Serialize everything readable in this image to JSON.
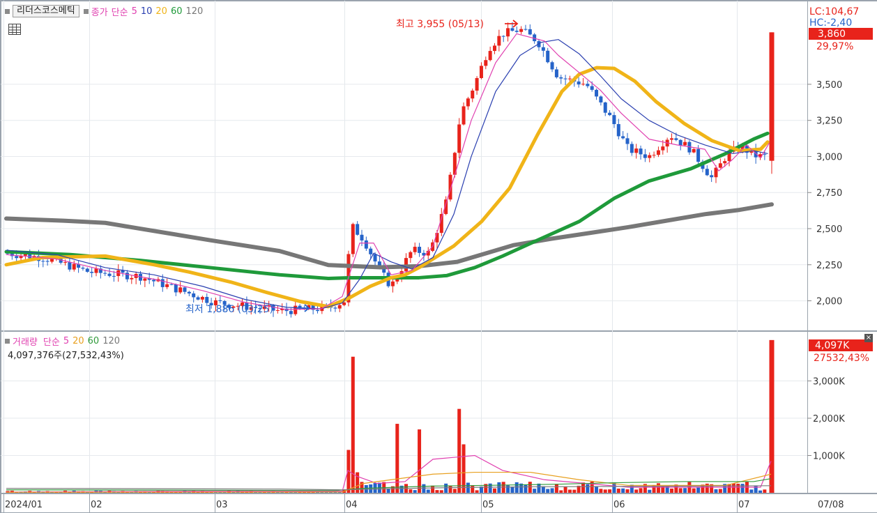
{
  "price_legend": {
    "title": "리더스코스메틱",
    "close_label": "종가",
    "ma_label": "단순",
    "periods": [
      "5",
      "10",
      "20",
      "60",
      "120"
    ]
  },
  "volume_legend": {
    "title": "거래량",
    "ma_label": "단순",
    "periods": [
      "5",
      "20",
      "60",
      "120"
    ],
    "readout": "4,097,376주(27,532,43%)"
  },
  "colors": {
    "up": "#e8231b",
    "down": "#2563c9",
    "ma5": "#e040b0",
    "ma10": "#2a3fb0",
    "ma20": "#f0b418",
    "ma60": "#1f9a3a",
    "ma120": "#777777",
    "vma5": "#e040b0",
    "vma20": "#e8a020",
    "vma60": "#2f9a3a",
    "vma120": "#7b7b7b"
  },
  "chart_data": [
    {
      "type": "candlestick",
      "title": "리더스코스메틱",
      "y_axis_labels": [
        "3,500",
        "3,250",
        "3,000",
        "2,750",
        "2,500",
        "2,250",
        "2,000"
      ],
      "ylim": [
        1800,
        4050
      ],
      "right_panel": {
        "lc": "LC:104,67",
        "hc": "HC:-2,40",
        "last_price": "3,860",
        "change_pct": "29,97%"
      },
      "annotations": {
        "high": "최고 3,955 (05/13)",
        "low": "최저 1,886 (03/25)"
      },
      "x_labels": [
        "2024/01",
        "02",
        "03",
        "04",
        "05",
        "06",
        "07",
        "07/08"
      ],
      "series": [
        {
          "name": "120",
          "points": [
            [
              2570,
              8
            ],
            [
              2555,
              90
            ],
            [
              2540,
              150
            ],
            [
              2500,
              200
            ],
            [
              2420,
              300
            ],
            [
              2345,
              400
            ],
            [
              2248,
              470
            ],
            [
              2232,
              545
            ],
            [
              2240,
              600
            ],
            [
              2270,
              655
            ],
            [
              2320,
              690
            ],
            [
              2385,
              735
            ],
            [
              2430,
              790
            ],
            [
              2470,
              845
            ],
            [
              2510,
              900
            ],
            [
              2555,
              955
            ],
            [
              2600,
              1010
            ],
            [
              2630,
              1060
            ],
            [
              2668,
              1106
            ]
          ]
        },
        {
          "name": "60",
          "points": [
            [
              2340,
              8
            ],
            [
              2320,
              100
            ],
            [
              2280,
              200
            ],
            [
              2230,
              300
            ],
            [
              2180,
              400
            ],
            [
              2155,
              470
            ],
            [
              2160,
              500
            ],
            [
              2160,
              545
            ],
            [
              2160,
              600
            ],
            [
              2175,
              640
            ],
            [
              2230,
              680
            ],
            [
              2310,
              720
            ],
            [
              2420,
              770
            ],
            [
              2550,
              830
            ],
            [
              2710,
              880
            ],
            [
              2830,
              930
            ],
            [
              2915,
              990
            ],
            [
              3020,
              1040
            ],
            [
              3120,
              1080
            ],
            [
              3160,
              1100
            ]
          ]
        },
        {
          "name": "20",
          "points": [
            [
              2250,
              8
            ],
            [
              2300,
              60
            ],
            [
              2310,
              150
            ],
            [
              2250,
              220
            ],
            [
              2200,
              270
            ],
            [
              2130,
              330
            ],
            [
              2060,
              380
            ],
            [
              1995,
              430
            ],
            [
              1960,
              470
            ],
            [
              2020,
              500
            ],
            [
              2100,
              530
            ],
            [
              2160,
              560
            ],
            [
              2180,
              580
            ],
            [
              2230,
              600
            ],
            [
              2290,
              620
            ],
            [
              2380,
              650
            ],
            [
              2550,
              690
            ],
            [
              2780,
              730
            ],
            [
              3150,
              770
            ],
            [
              3450,
              805
            ],
            [
              3570,
              830
            ],
            [
              3615,
              855
            ],
            [
              3610,
              880
            ],
            [
              3520,
              910
            ],
            [
              3380,
              940
            ],
            [
              3230,
              980
            ],
            [
              3110,
              1020
            ],
            [
              3040,
              1060
            ],
            [
              3050,
              1090
            ],
            [
              3100,
              1100
            ]
          ]
        },
        {
          "name": "10",
          "points": [
            [
              2350,
              8
            ],
            [
              2320,
              80
            ],
            [
              2230,
              150
            ],
            [
              2180,
              220
            ],
            [
              2100,
              290
            ],
            [
              2010,
              350
            ],
            [
              1955,
              410
            ],
            [
              1945,
              460
            ],
            [
              1985,
              490
            ],
            [
              2150,
              515
            ],
            [
              2330,
              535
            ],
            [
              2270,
              560
            ],
            [
              2220,
              590
            ],
            [
              2300,
              620
            ],
            [
              2600,
              650
            ],
            [
              3000,
              675
            ],
            [
              3450,
              710
            ],
            [
              3700,
              745
            ],
            [
              3790,
              775
            ],
            [
              3810,
              800
            ],
            [
              3710,
              830
            ],
            [
              3560,
              860
            ],
            [
              3400,
              890
            ],
            [
              3250,
              930
            ],
            [
              3150,
              970
            ],
            [
              3080,
              1010
            ],
            [
              3020,
              1050
            ],
            [
              3040,
              1080
            ],
            [
              3020,
              1100
            ]
          ]
        },
        {
          "name": "5",
          "points": [
            [
              2320,
              8
            ],
            [
              2290,
              80
            ],
            [
              2210,
              150
            ],
            [
              2150,
              220
            ],
            [
              2070,
              290
            ],
            [
              1990,
              350
            ],
            [
              1940,
              410
            ],
            [
              1945,
              460
            ],
            [
              2030,
              490
            ],
            [
              2400,
              515
            ],
            [
              2400,
              535
            ],
            [
              2180,
              560
            ],
            [
              2210,
              590
            ],
            [
              2380,
              620
            ],
            [
              2850,
              650
            ],
            [
              3250,
              675
            ],
            [
              3650,
              710
            ],
            [
              3850,
              740
            ],
            [
              3800,
              780
            ],
            [
              3700,
              800
            ],
            [
              3580,
              830
            ],
            [
              3460,
              860
            ],
            [
              3300,
              890
            ],
            [
              3120,
              930
            ],
            [
              3080,
              970
            ],
            [
              3050,
              1010
            ],
            [
              2900,
              1030
            ],
            [
              2980,
              1050
            ],
            [
              3080,
              1070
            ],
            [
              2990,
              1090
            ],
            [
              3090,
              1102
            ]
          ]
        }
      ]
    },
    {
      "type": "bar",
      "title": "거래량",
      "y_axis_labels": [
        "3,000K",
        "2,000K",
        "1,000K"
      ],
      "ylim": [
        0,
        4300
      ],
      "right_panel": {
        "last_volume": "4,097K",
        "volume_pct": "27532,43%"
      },
      "series": [
        {
          "name": "5",
          "points": [
            [
              20,
              8
            ],
            [
              40,
              300
            ],
            [
              40,
              490
            ],
            [
              600,
              498
            ],
            [
              450,
              510
            ],
            [
              250,
              540
            ],
            [
              300,
              580
            ],
            [
              900,
              620
            ],
            [
              950,
              650
            ],
            [
              1000,
              680
            ],
            [
              600,
              720
            ],
            [
              350,
              780
            ],
            [
              150,
              900
            ],
            [
              150,
              1090
            ],
            [
              850,
              1105
            ]
          ]
        },
        {
          "name": "20",
          "points": [
            [
              15,
              8
            ],
            [
              20,
              490
            ],
            [
              250,
              520
            ],
            [
              350,
              560
            ],
            [
              500,
              620
            ],
            [
              550,
              680
            ],
            [
              550,
              760
            ],
            [
              350,
              830
            ],
            [
              200,
              900
            ],
            [
              200,
              1040
            ],
            [
              500,
              1105
            ]
          ]
        },
        {
          "name": "60",
          "points": [
            [
              80,
              8
            ],
            [
              60,
              480
            ],
            [
              120,
              520
            ],
            [
              180,
              620
            ],
            [
              200,
              700
            ],
            [
              230,
              800
            ],
            [
              270,
              880
            ],
            [
              300,
              980
            ],
            [
              300,
              1080
            ],
            [
              380,
              1105
            ]
          ]
        },
        {
          "name": "120",
          "points": [
            [
              120,
              8
            ],
            [
              100,
              400
            ],
            [
              80,
              490
            ],
            [
              110,
              560
            ],
            [
              140,
              650
            ],
            [
              160,
              760
            ],
            [
              170,
              880
            ],
            [
              180,
              1000
            ],
            [
              190,
              1105
            ]
          ]
        }
      ]
    }
  ]
}
